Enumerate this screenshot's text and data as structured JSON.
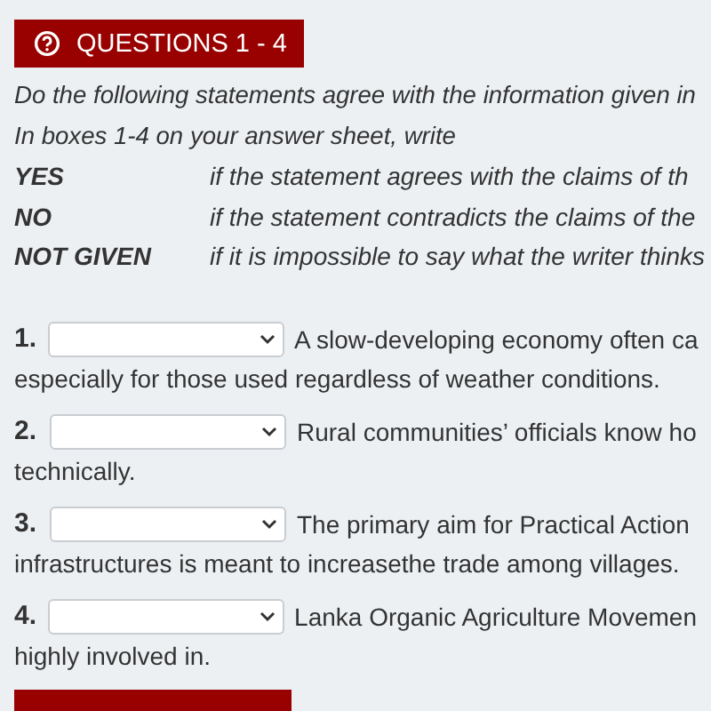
{
  "sections": [
    {
      "title": "QUESTIONS 1 - 4",
      "instructions": [
        "Do the following statements agree with the information given in",
        "In boxes 1-4 on your answer sheet, write"
      ],
      "legend": [
        {
          "label": "YES",
          "meaning": "if the statement agrees with the claims of th"
        },
        {
          "label": "NO",
          "meaning": "if the statement contradicts the claims of the"
        },
        {
          "label": "NOT GIVEN",
          "meaning": "if it is impossible to say what the writer thinks"
        }
      ],
      "questions": [
        {
          "number": "1.",
          "text": "A slow-developing economy often ca",
          "continuation": "especially for those used regardless of weather conditions."
        },
        {
          "number": "2.",
          "text": "Rural communities’ officials know ho",
          "continuation": "technically."
        },
        {
          "number": "3.",
          "text": "The primary aim for Practical Action",
          "continuation": "infrastructures is meant to increasethe trade among villages."
        },
        {
          "number": "4.",
          "text": "Lanka Organic Agriculture Movemen",
          "continuation": "highly involved in."
        }
      ]
    }
  ],
  "next_section_bar": true
}
